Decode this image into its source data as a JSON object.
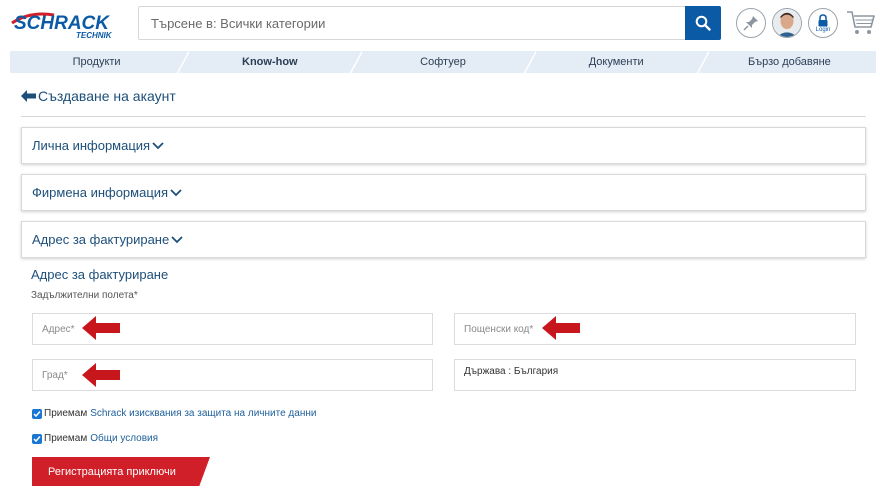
{
  "header": {
    "logo_text": "SCHRACK",
    "logo_subtext": "TECHNIK",
    "search_placeholder": "Търсене в: Всички категории",
    "login_label": "Login",
    "icons": [
      "search-icon",
      "pin-icon",
      "avatar",
      "lock-icon",
      "cart-icon"
    ]
  },
  "nav": {
    "items": [
      {
        "label": "Продукти",
        "bold": false
      },
      {
        "label": "Know-how",
        "bold": true
      },
      {
        "label": "Софтуер",
        "bold": false
      },
      {
        "label": "Документи",
        "bold": false
      },
      {
        "label": "Бързо добавяне",
        "bold": false
      }
    ]
  },
  "page": {
    "title": "Създаване на акаунт",
    "accordions": [
      "Лична информация",
      "Фирмена информация",
      "Адрес за фактуриране"
    ],
    "section_heading": "Адрес за фактуриране",
    "required_note": "Задължителни полета*"
  },
  "form": {
    "address_placeholder": "Адрес*",
    "postal_placeholder": "Пощенски код*",
    "city_placeholder": "Град*",
    "country_text": "Държава : България"
  },
  "consents": {
    "privacy_prefix": "Приемам",
    "privacy_link": "Schrack изисквания за защита на личните данни",
    "terms_prefix": "Приемам",
    "terms_link": "Общи условия"
  },
  "submit_label": "Регистрацията приключи",
  "colors": {
    "primary_blue": "#0b5aa6",
    "nav_bg": "#e4edf6",
    "title_blue": "#1d4f7a",
    "accent_red": "#d01f28",
    "arrow_red": "#c8161d"
  }
}
